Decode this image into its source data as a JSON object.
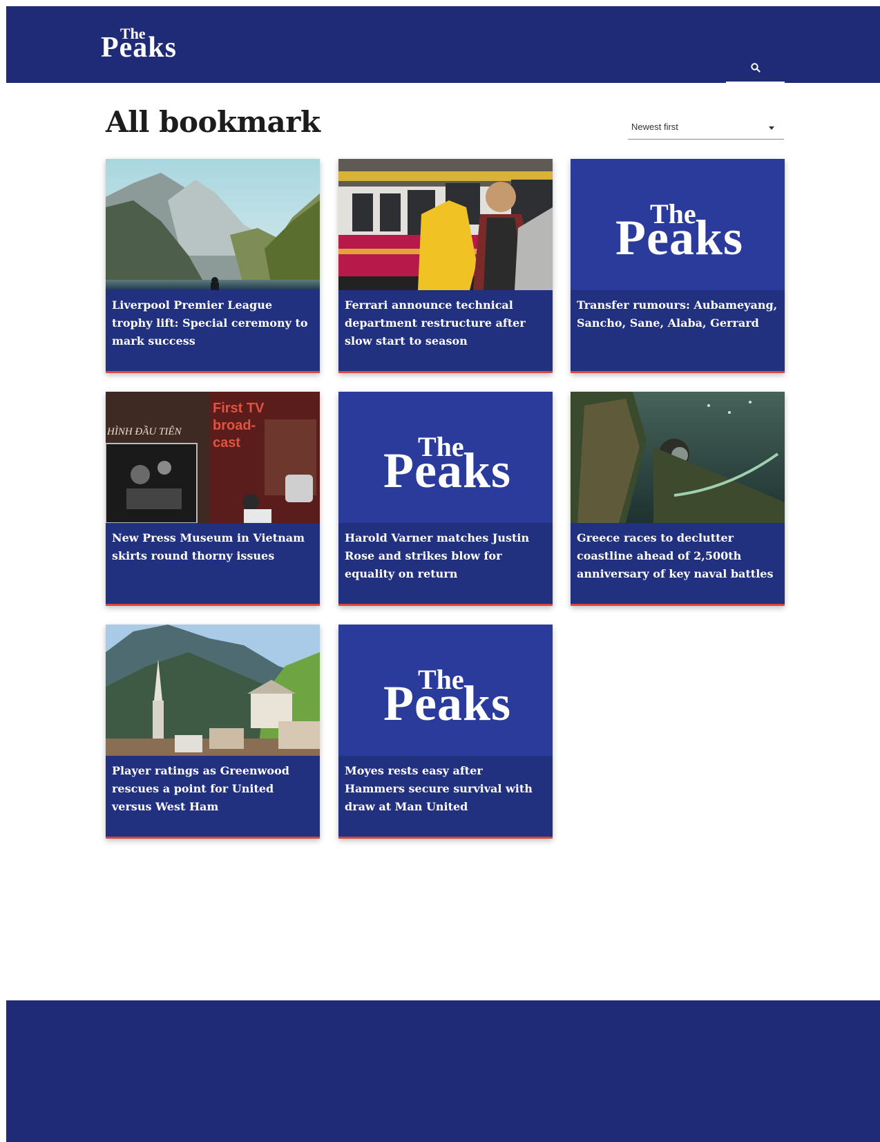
{
  "header": {
    "logo": {
      "top": "The",
      "bottom": "Peaks"
    },
    "search_icon": "search-icon"
  },
  "page": {
    "title": "All bookmark",
    "sort": {
      "selected": "Newest first"
    }
  },
  "cards": [
    {
      "title": "Liverpool Premier League trophy lift: Special ceremony to mark success",
      "image": "mountain lake with person"
    },
    {
      "title": "Ferrari announce technical department restructure after slow start to season",
      "image": "train with traveler"
    },
    {
      "title": "Transfer rumours: Aubameyang, Sancho, Sane, Alaba, Gerrard",
      "image": "logo-placeholder"
    },
    {
      "title": "New Press Museum in Vietnam skirts round thorny issues",
      "image": "museum exhibit"
    },
    {
      "title": "Harold Varner matches Justin Rose and strikes blow for equality on return",
      "image": "logo-placeholder"
    },
    {
      "title": "Greece races to declutter coastline ahead of 2,500th anniversary of key naval battles",
      "image": "underwater diver"
    },
    {
      "title": "Player ratings as Greenwood rescues a point for United versus West Ham",
      "image": "alpine village"
    },
    {
      "title": "Moyes rests easy after Hammers secure survival with draw at Man United",
      "image": "logo-placeholder"
    }
  ],
  "placeholder_logo": {
    "top": "The",
    "bottom": "Peaks"
  },
  "museum_sign": {
    "left": "HÌNH ĐẦU TIÊN",
    "right_line1": "First TV",
    "right_line2": "broad-",
    "right_line3": "cast"
  },
  "colors": {
    "navy": "#1f2b77",
    "brand_blue": "#2a3b9c",
    "accent_red": "#d9473d"
  }
}
